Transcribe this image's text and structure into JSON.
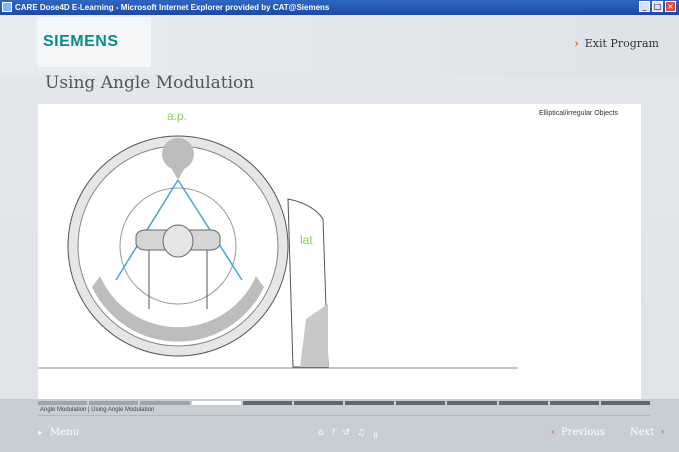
{
  "window": {
    "title": "CARE Dose4D E-Learning - Microsoft Internet Explorer provided by CAT@Siemens",
    "controls": [
      "_",
      "□",
      "×"
    ]
  },
  "header": {
    "logo": "SIEMENS",
    "exit_label": "Exit Program",
    "page_title": "Using Angle Modulation"
  },
  "diagram": {
    "label_ap": "a.p.",
    "label_lat": "lat",
    "accent_color": "#8ecb62",
    "beam_color": "#4aa3d8"
  },
  "side_panel": {
    "label": "Elliptical/irregular Objects"
  },
  "footer": {
    "breadcrumb": "Angle Modulation | Using Angle Modulation",
    "menu_label": "Menu",
    "previous_label": "Previous",
    "next_label": "Next",
    "tools": [
      {
        "icon": "home-icon",
        "glyph": "⌂"
      },
      {
        "icon": "help-icon",
        "glyph": "?"
      },
      {
        "icon": "replay-icon",
        "glyph": "↺"
      },
      {
        "icon": "audio-icon",
        "glyph": "♫"
      },
      {
        "icon": "pause-icon",
        "glyph": "॥"
      }
    ],
    "progress": {
      "total_segments": 12,
      "current_segment": 4
    }
  }
}
